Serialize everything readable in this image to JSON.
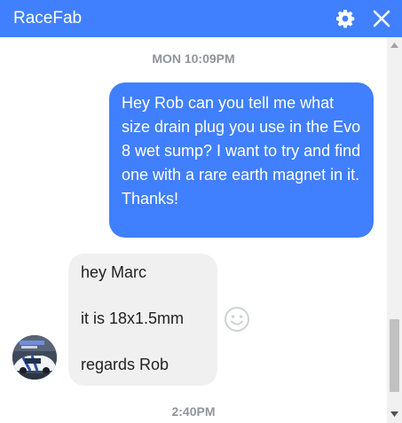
{
  "header": {
    "title": "RaceFab",
    "settings_icon": "gear-icon",
    "close_icon": "close-icon",
    "color": "#4080ff"
  },
  "conversation": {
    "timestamp_1": "MON 10:09PM",
    "outgoing_message": "Hey Rob can you tell me what size drain plug you use in the Evo 8 wet sump? I want to try and find one with a rare earth magnet in it. Thanks!",
    "incoming_message": {
      "line_1": "hey Marc",
      "line_2": "it is 18x1.5mm",
      "line_3": "regards Rob"
    },
    "timestamp_2": "2:40PM"
  },
  "colors": {
    "outgoing_bubble": "#4080ff",
    "incoming_bubble": "#f1f0f0",
    "timestamp_text": "#90949c"
  }
}
